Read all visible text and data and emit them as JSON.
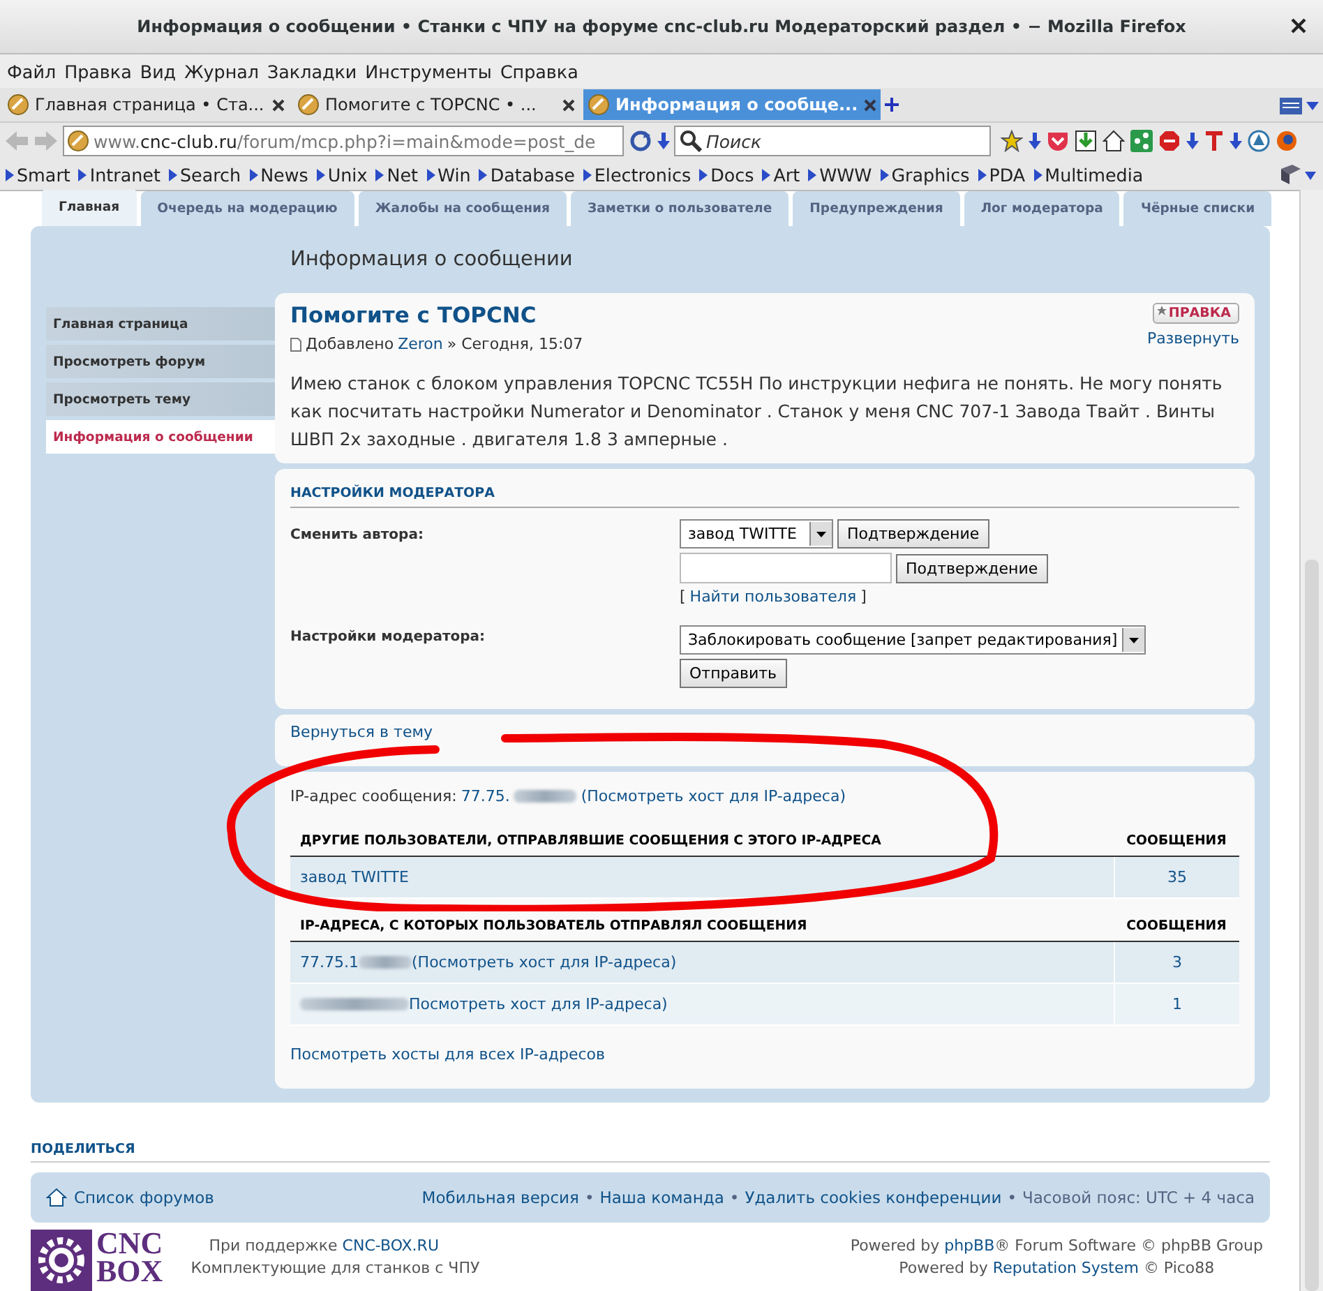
{
  "window": {
    "title": "Информация о сообщении • Станки с ЧПУ на форуме cnc-club.ru Модераторский раздел • − Mozilla Firefox"
  },
  "menu": [
    "Файл",
    "Правка",
    "Вид",
    "Журнал",
    "Закладки",
    "Инструменты",
    "Справка"
  ],
  "browser_tabs": [
    {
      "label": "Главная страница • Ста...",
      "selected": false
    },
    {
      "label": "Помогите с TOPCNC • ...",
      "selected": false
    },
    {
      "label": "Информация о сообще...",
      "selected": true
    }
  ],
  "address_bar": {
    "url": "www.**cnc-club.ru**/forum/mcp.php?i=main&mode=post_de"
  },
  "search": {
    "placeholder": "Поиск"
  },
  "bookmarks": [
    "Smart",
    "Intranet",
    "Search",
    "News",
    "Unix",
    "Net",
    "Win",
    "Database",
    "Electronics",
    "Docs",
    "Art",
    "WWW",
    "Graphics",
    "PDA",
    "Multimedia"
  ],
  "mcp_tabs": [
    {
      "label": "Главная",
      "selected": true
    },
    {
      "label": "Очередь на модерацию",
      "selected": false
    },
    {
      "label": "Жалобы на сообщения",
      "selected": false
    },
    {
      "label": "Заметки о пользователе",
      "selected": false
    },
    {
      "label": "Предупреждения",
      "selected": false
    },
    {
      "label": "Лог модератора",
      "selected": false
    },
    {
      "label": "Чёрные списки",
      "selected": false
    }
  ],
  "page_title": "Информация о сообщении",
  "sidebar": [
    {
      "label": "Главная страница",
      "selected": false
    },
    {
      "label": "Просмотреть форум",
      "selected": false
    },
    {
      "label": "Просмотреть тему",
      "selected": false
    },
    {
      "label": "Информация о сообщении",
      "selected": true
    }
  ],
  "post": {
    "title": "Помогите с TOPCNC",
    "meta_prefix": "Добавлено",
    "author": "Zeron",
    "meta_suffix": "» Сегодня, 15:07",
    "body": "Имею станок с блоком управления TOPCNC TC55H По инструкции нефига не понять. Не могу понять как посчитать настройки Numerator и Denominator . Станок у меня CNC 707-1 Завода Твайт . Винты ШВП 2х заходные . двигателя 1.8 3 амперные .",
    "edit_badge": "ПРАВКА",
    "expand_link": "Развернуть"
  },
  "moderator_settings": {
    "heading": "НАСТРОЙКИ МОДЕРАТОРА",
    "change_author_label": "Сменить автора:",
    "author_select": "завод TWITTE",
    "confirm_button": "Подтверждение",
    "confirm_button_2": "Подтверждение",
    "find_user_open": "[",
    "find_user_link": "Найти пользователя",
    "find_user_close": "]",
    "settings_label": "Настройки модератора:",
    "action_select": "Заблокировать сообщение [запрет редактирования]",
    "submit_button": "Отправить"
  },
  "back_link": "Вернуться в тему",
  "ip_info": {
    "label": "IP-адрес сообщения:",
    "ip": "77.75.",
    "host_link": "(Посмотреть хост для IP-адреса)"
  },
  "users_table": {
    "columns": [
      "ДРУГИЕ ПОЛЬЗОВАТЕЛИ, ОТПРАВЛЯВШИЕ СООБЩЕНИЯ С ЭТОГО IP-АДРЕСА",
      "СООБЩЕНИЯ"
    ],
    "rows": [
      {
        "name": "завод TWITTE",
        "count": "35"
      }
    ]
  },
  "ips_table": {
    "columns": [
      "IP-АДРЕСА, С КОТОРЫХ ПОЛЬЗОВАТЕЛЬ ОТПРАВЛЯЛ СООБЩЕНИЯ",
      "СООБЩЕНИЯ"
    ],
    "rows": [
      {
        "ip": "77.75.1",
        "host_link": "(Посмотреть хост для IP-адреса)",
        "count": "3"
      },
      {
        "ip": "",
        "host_link": "Посмотреть хост для IP-адреса)",
        "count": "1"
      }
    ]
  },
  "all_hosts_link": "Посмотреть хосты для всех IP-адресов",
  "share_heading": "ПОДЕЛИТЬСЯ",
  "footer_nav": {
    "forum_list": "Список форумов",
    "separator": "•",
    "links": [
      "Мобильная версия",
      "Наша команда",
      "Удалить cookies конференции"
    ],
    "timezone": "Часовой пояс: UTC + 4 часа"
  },
  "credits": {
    "logo_top": "CNC",
    "logo_bottom": "BOX",
    "support_prefix": "При поддержке",
    "support_link": "CNC-BOX.RU",
    "support_tagline": "Комплектующие для станков с ЧПУ",
    "powered": [
      {
        "before": "Powered by",
        "link": "phpBB",
        "after": "® Forum Software © phpBB Group"
      },
      {
        "before": "Powered by",
        "link": "Reputation System",
        "after": "© Pico88"
      }
    ]
  }
}
